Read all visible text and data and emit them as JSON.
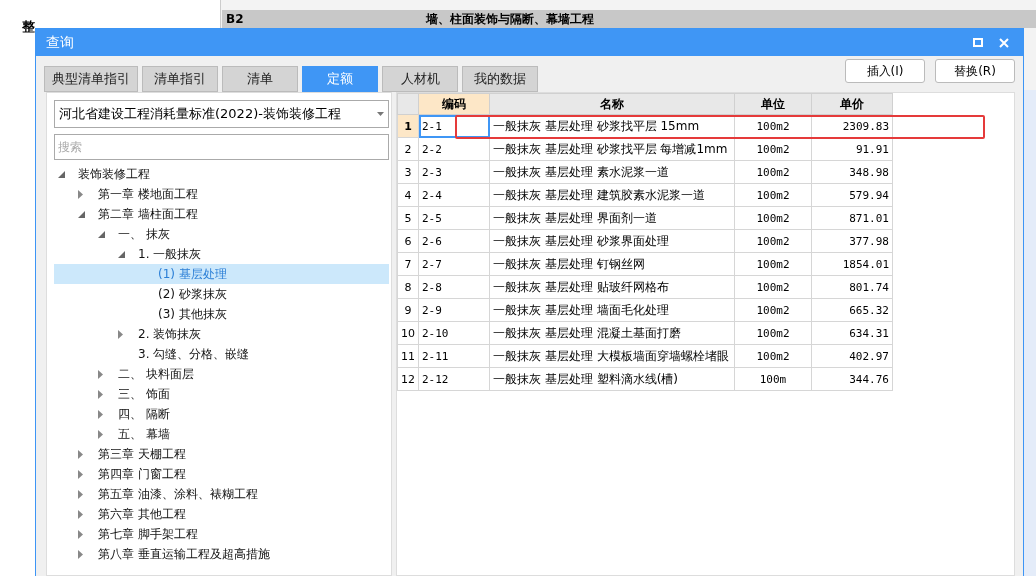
{
  "background": {
    "project_label": "整",
    "row_code": "B2",
    "row_title": "墙、柱面装饰与隔断、幕墙工程"
  },
  "window": {
    "title": "查询"
  },
  "tabs": [
    {
      "label": "典型清单指引",
      "selected": false
    },
    {
      "label": "清单指引",
      "selected": false
    },
    {
      "label": "清单",
      "selected": false
    },
    {
      "label": "定额",
      "selected": true
    },
    {
      "label": "人材机",
      "selected": false
    },
    {
      "label": "我的数据",
      "selected": false
    }
  ],
  "actions": [
    "插入(I)",
    "替换(R)"
  ],
  "library": {
    "value": "河北省建设工程消耗量标准(2022)-装饰装修工程"
  },
  "search": {
    "placeholder": "搜索"
  },
  "tree": [
    {
      "label": "装饰装修工程",
      "expanded": true,
      "selected": false,
      "children": [
        {
          "label": "第一章 楼地面工程",
          "expanded": false,
          "selected": false
        },
        {
          "label": "第二章 墙柱面工程",
          "expanded": true,
          "selected": false,
          "children": [
            {
              "label": "一、  抹灰",
              "expanded": true,
              "selected": false,
              "children": [
                {
                  "label": "1. 一般抹灰",
                  "expanded": true,
                  "selected": false,
                  "children": [
                    {
                      "label": "(1) 基层处理",
                      "selected": true
                    },
                    {
                      "label": "(2) 砂浆抹灰",
                      "selected": false
                    },
                    {
                      "label": "(3) 其他抹灰",
                      "selected": false
                    }
                  ]
                },
                {
                  "label": "2. 装饰抹灰",
                  "expanded": false,
                  "selected": false
                },
                {
                  "label": "3. 勾缝、分格、嵌缝",
                  "selected": false
                }
              ]
            },
            {
              "label": "二、  块料面层",
              "expanded": false,
              "selected": false
            },
            {
              "label": "三、  饰面",
              "expanded": false,
              "selected": false
            },
            {
              "label": "四、  隔断",
              "expanded": false,
              "selected": false
            },
            {
              "label": "五、  幕墙",
              "expanded": false,
              "selected": false
            }
          ]
        },
        {
          "label": "第三章 天棚工程",
          "expanded": false,
          "selected": false
        },
        {
          "label": "第四章 门窗工程",
          "expanded": false,
          "selected": false
        },
        {
          "label": "第五章 油漆、涂料、裱糊工程",
          "expanded": false,
          "selected": false
        },
        {
          "label": "第六章 其他工程",
          "expanded": false,
          "selected": false
        },
        {
          "label": "第七章 脚手架工程",
          "expanded": false,
          "selected": false
        },
        {
          "label": "第八章 垂直运输工程及超高措施",
          "expanded": false,
          "selected": false
        }
      ]
    }
  ],
  "table": {
    "columns": [
      "编码",
      "名称",
      "单位",
      "单价"
    ],
    "rows": [
      {
        "index": "1",
        "code": "2-1",
        "name": "一般抹灰 基层处理 砂浆找平层 15mm",
        "unit": "100m2",
        "price": "2309.83",
        "selected": true
      },
      {
        "index": "2",
        "code": "2-2",
        "name": "一般抹灰 基层处理 砂浆找平层 每增减1mm",
        "unit": "100m2",
        "price": "91.91",
        "selected": false
      },
      {
        "index": "3",
        "code": "2-3",
        "name": "一般抹灰 基层处理 素水泥浆一道",
        "unit": "100m2",
        "price": "348.98",
        "selected": false
      },
      {
        "index": "4",
        "code": "2-4",
        "name": "一般抹灰 基层处理 建筑胶素水泥浆一道",
        "unit": "100m2",
        "price": "579.94",
        "selected": false
      },
      {
        "index": "5",
        "code": "2-5",
        "name": "一般抹灰 基层处理 界面剂一道",
        "unit": "100m2",
        "price": "871.01",
        "selected": false
      },
      {
        "index": "6",
        "code": "2-6",
        "name": "一般抹灰 基层处理 砂浆界面处理",
        "unit": "100m2",
        "price": "377.98",
        "selected": false
      },
      {
        "index": "7",
        "code": "2-7",
        "name": "一般抹灰 基层处理 钉钢丝网",
        "unit": "100m2",
        "price": "1854.01",
        "selected": false
      },
      {
        "index": "8",
        "code": "2-8",
        "name": "一般抹灰 基层处理 贴玻纤网格布",
        "unit": "100m2",
        "price": "801.74",
        "selected": false
      },
      {
        "index": "9",
        "code": "2-9",
        "name": "一般抹灰 基层处理 墙面毛化处理",
        "unit": "100m2",
        "price": "665.32",
        "selected": false
      },
      {
        "index": "10",
        "code": "2-10",
        "name": "一般抹灰 基层处理 混凝土基面打磨",
        "unit": "100m2",
        "price": "634.31",
        "selected": false
      },
      {
        "index": "11",
        "code": "2-11",
        "name": "一般抹灰 基层处理 大模板墙面穿墙螺栓堵眼",
        "unit": "100m2",
        "price": "402.97",
        "selected": false
      },
      {
        "index": "12",
        "code": "2-12",
        "name": "一般抹灰 基层处理 塑料滴水线(槽)",
        "unit": "100m",
        "price": "344.76",
        "selected": false
      }
    ]
  }
}
